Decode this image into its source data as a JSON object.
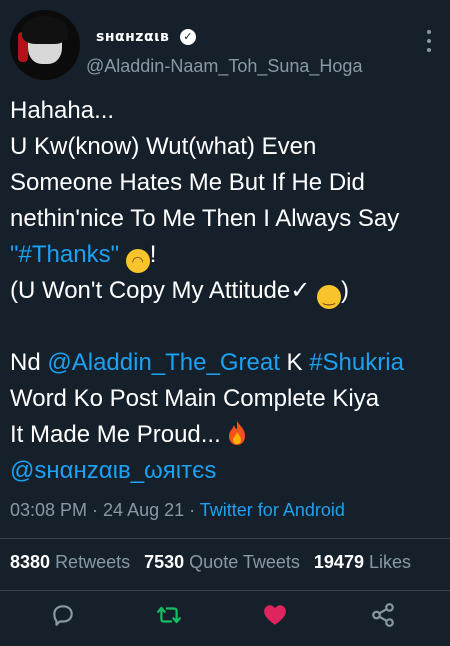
{
  "user": {
    "display_name": "ѕнαнzαιв",
    "verified_icon": "verified-badge-icon",
    "handle": "@Aladdin-Naam_Toh_Suna_Hoga"
  },
  "tweet": {
    "line1": "Hahaha...",
    "line2": "U Kw(know) Wut(what) Even",
    "line3": "Someone Hates Me But If He Did",
    "line4": "nethin'nice To Me Then I Always Say",
    "line5_prefix": "\"",
    "line5_hashtag": "#Thanks",
    "line5_suffix": "\" ",
    "line5_end": "!",
    "line6_text": "(U Won't Copy My Attitude✓ ",
    "line6_end": ")",
    "line8_prefix": "Nd ",
    "line8_mention": "@Aladdin_The_Great",
    "line8_mid": " K ",
    "line8_hashtag": "#Shukria",
    "line9": "Word Ko Post Main Complete Kiya",
    "line10": "It Made Me Proud...",
    "line11_mention": "@ѕнαнzαιв_ωяιтєѕ"
  },
  "meta": {
    "time": "03:08 PM · 24 Aug 21 · ",
    "source": "Twitter for Android"
  },
  "stats": {
    "retweets_count": "8380",
    "retweets_label": "Retweets",
    "quotes_count": "7530",
    "quotes_label": "Quote Tweets",
    "likes_count": "19479",
    "likes_label": "Likes"
  },
  "colors": {
    "background": "#15202b",
    "link": "#1da1f2",
    "muted": "#8899a6",
    "retweet": "#17bf63",
    "like": "#e0245e"
  }
}
